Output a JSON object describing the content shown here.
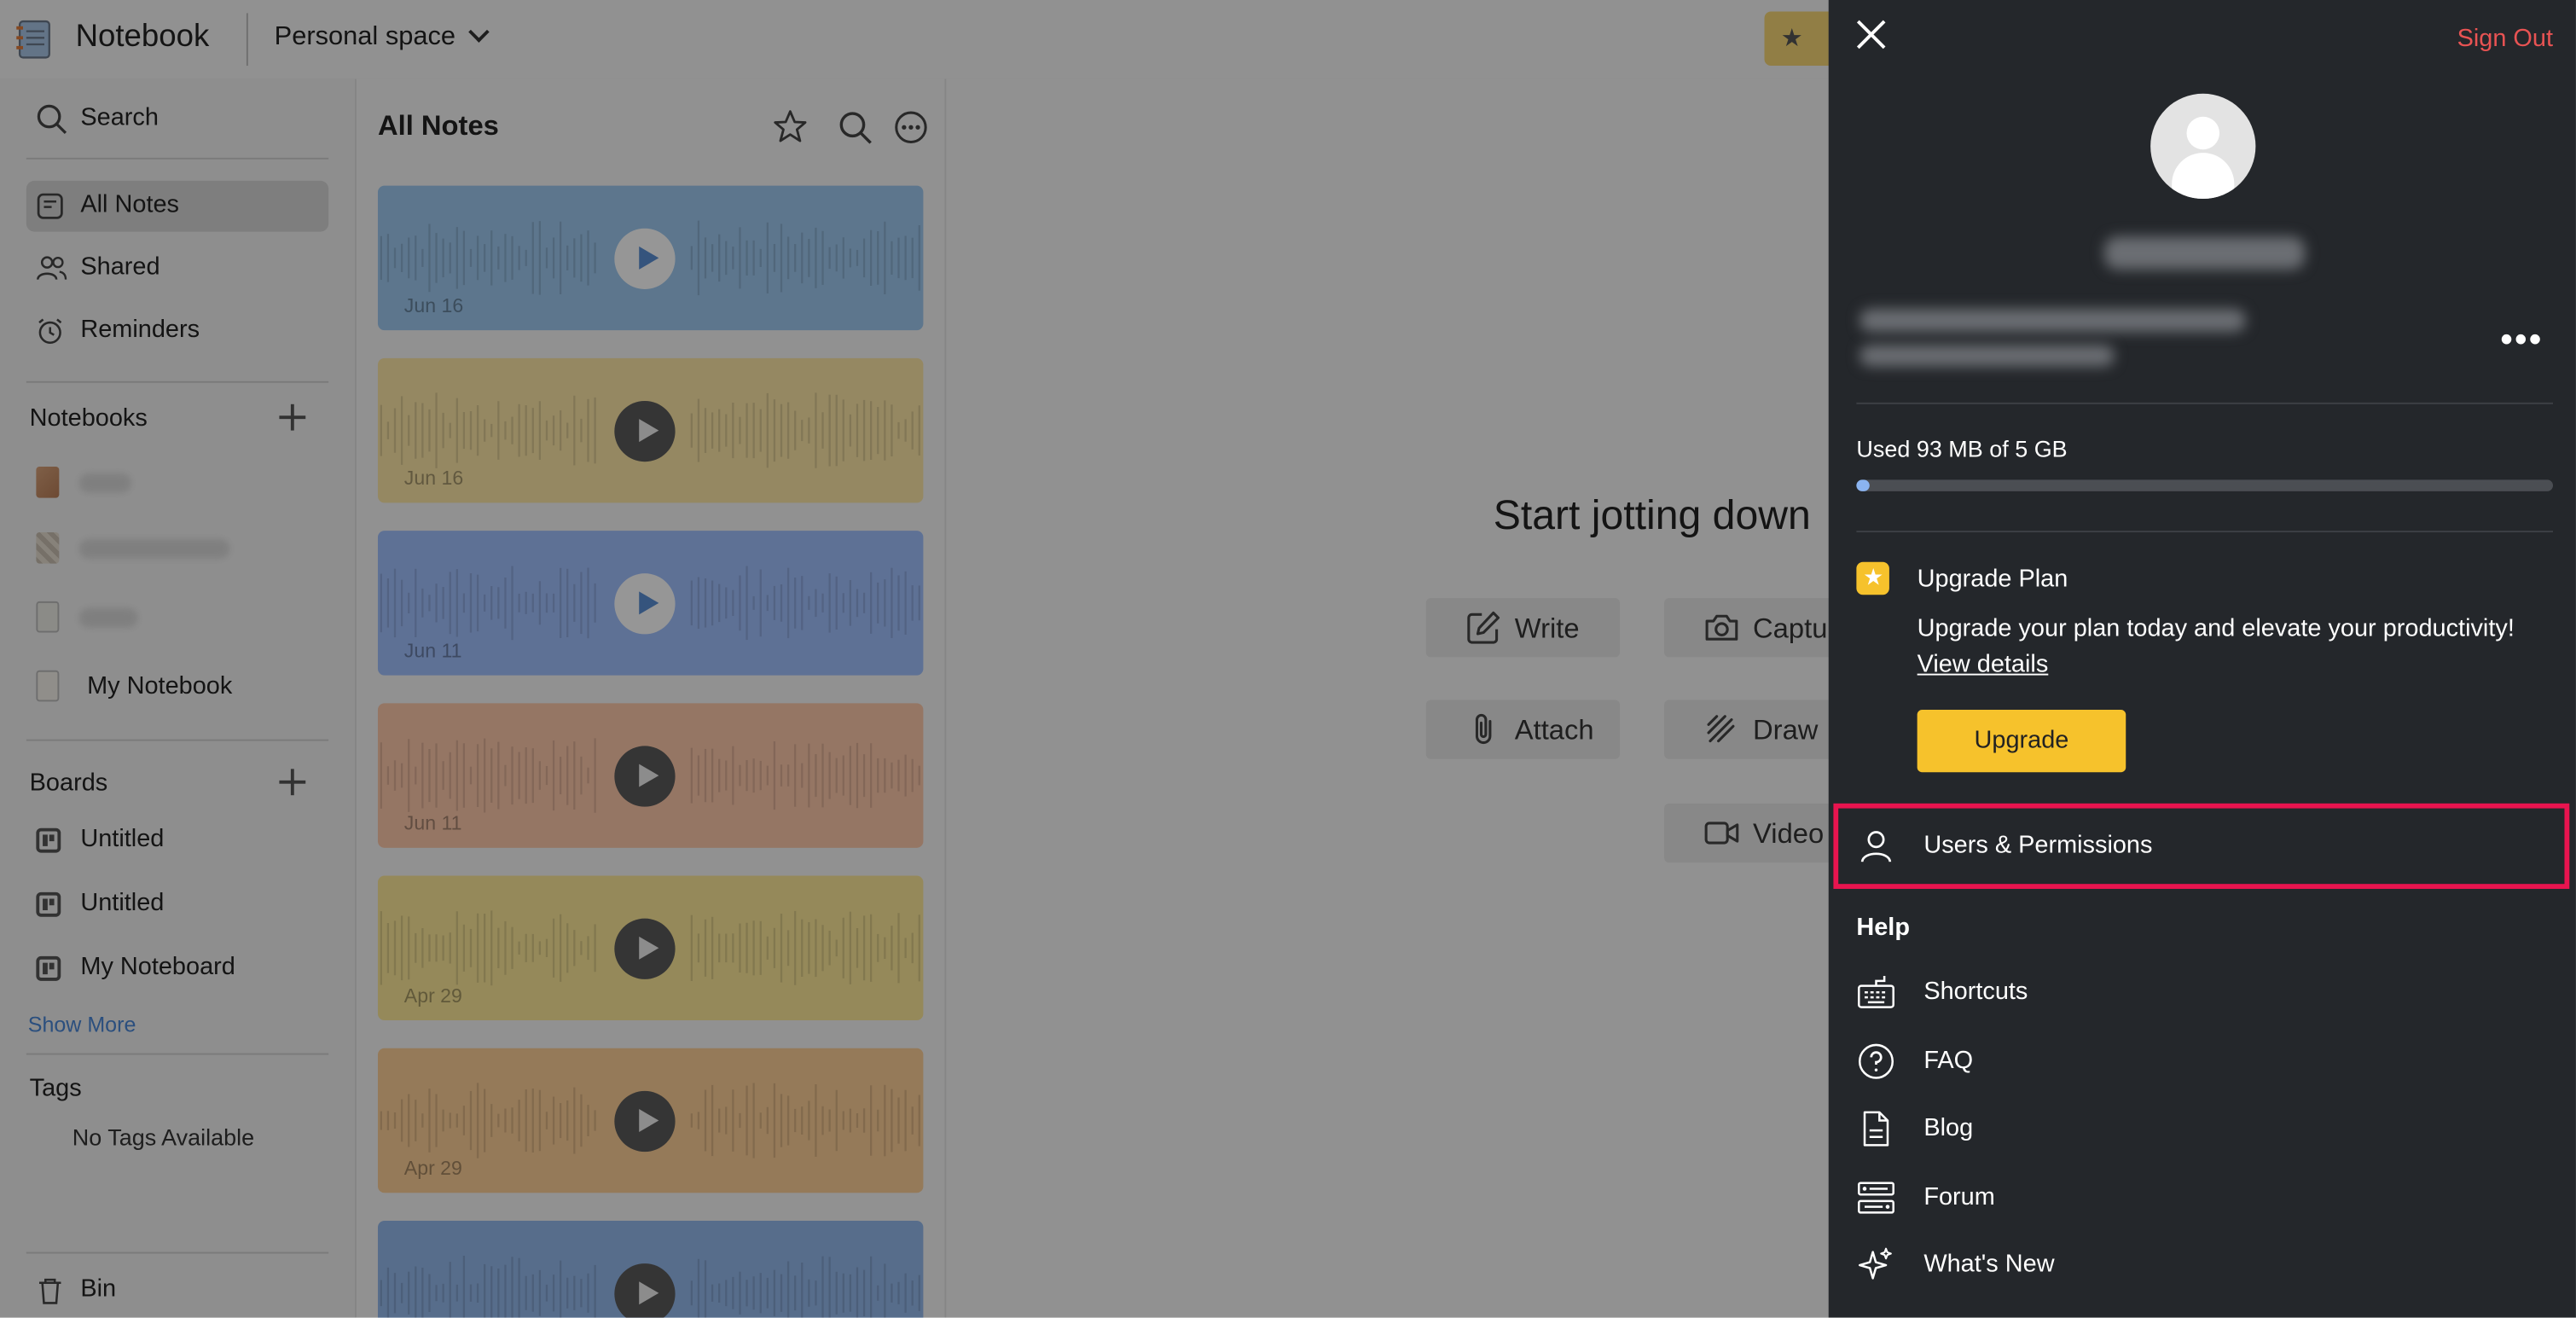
{
  "header": {
    "app_title": "Notebook",
    "space_label": "Personal space"
  },
  "sidebar": {
    "search_label": "Search",
    "nav": [
      {
        "label": "All Notes",
        "active": true
      },
      {
        "label": "Shared"
      },
      {
        "label": "Reminders"
      }
    ],
    "notebooks_heading": "Notebooks",
    "notebooks": [
      {
        "label": "My Notebook"
      }
    ],
    "boards_heading": "Boards",
    "boards": [
      {
        "label": "Untitled"
      },
      {
        "label": "Untitled"
      },
      {
        "label": "My Noteboard"
      }
    ],
    "show_more": "Show More",
    "tags_heading": "Tags",
    "no_tags": "No Tags Available",
    "bin_label": "Bin"
  },
  "notes_list": {
    "title": "All Notes",
    "cards": [
      {
        "date": "Jun 16",
        "color": "#9ec9f0"
      },
      {
        "date": "Jun 16",
        "color": "#fde7a7"
      },
      {
        "date": "Jun 11",
        "color": "#a1c0fe"
      },
      {
        "date": "Jun 11",
        "color": "#fec9ab"
      },
      {
        "date": "Apr 29",
        "color": "#fde99a"
      },
      {
        "date": "Apr 29",
        "color": "#fdcf97"
      },
      {
        "date": "",
        "color": "#95b9ec"
      }
    ]
  },
  "main": {
    "headline": "Start jotting down",
    "actions": {
      "write": "Write",
      "capture": "Capture",
      "attach": "Attach",
      "draw": "Draw",
      "video": "Video"
    }
  },
  "profile_panel": {
    "sign_out": "Sign Out",
    "storage_text": "Used 93 MB of 5 GB",
    "storage_used_fraction": 0.019,
    "upgrade": {
      "title": "Upgrade Plan",
      "description": "Upgrade your plan today and elevate your productivity!",
      "link": "View details",
      "button": "Upgrade"
    },
    "users_permissions": "Users & Permissions",
    "help_heading": "Help",
    "help_items": [
      {
        "label": "Shortcuts"
      },
      {
        "label": "FAQ"
      },
      {
        "label": "Blog"
      },
      {
        "label": "Forum"
      },
      {
        "label": "What's New"
      }
    ]
  },
  "colors": {
    "panel_bg": "#24272b",
    "sign_out": "#e85353",
    "accent_yellow": "#f6c22c",
    "highlight_border": "#e8144f",
    "link_blue": "#5a8fd4"
  }
}
